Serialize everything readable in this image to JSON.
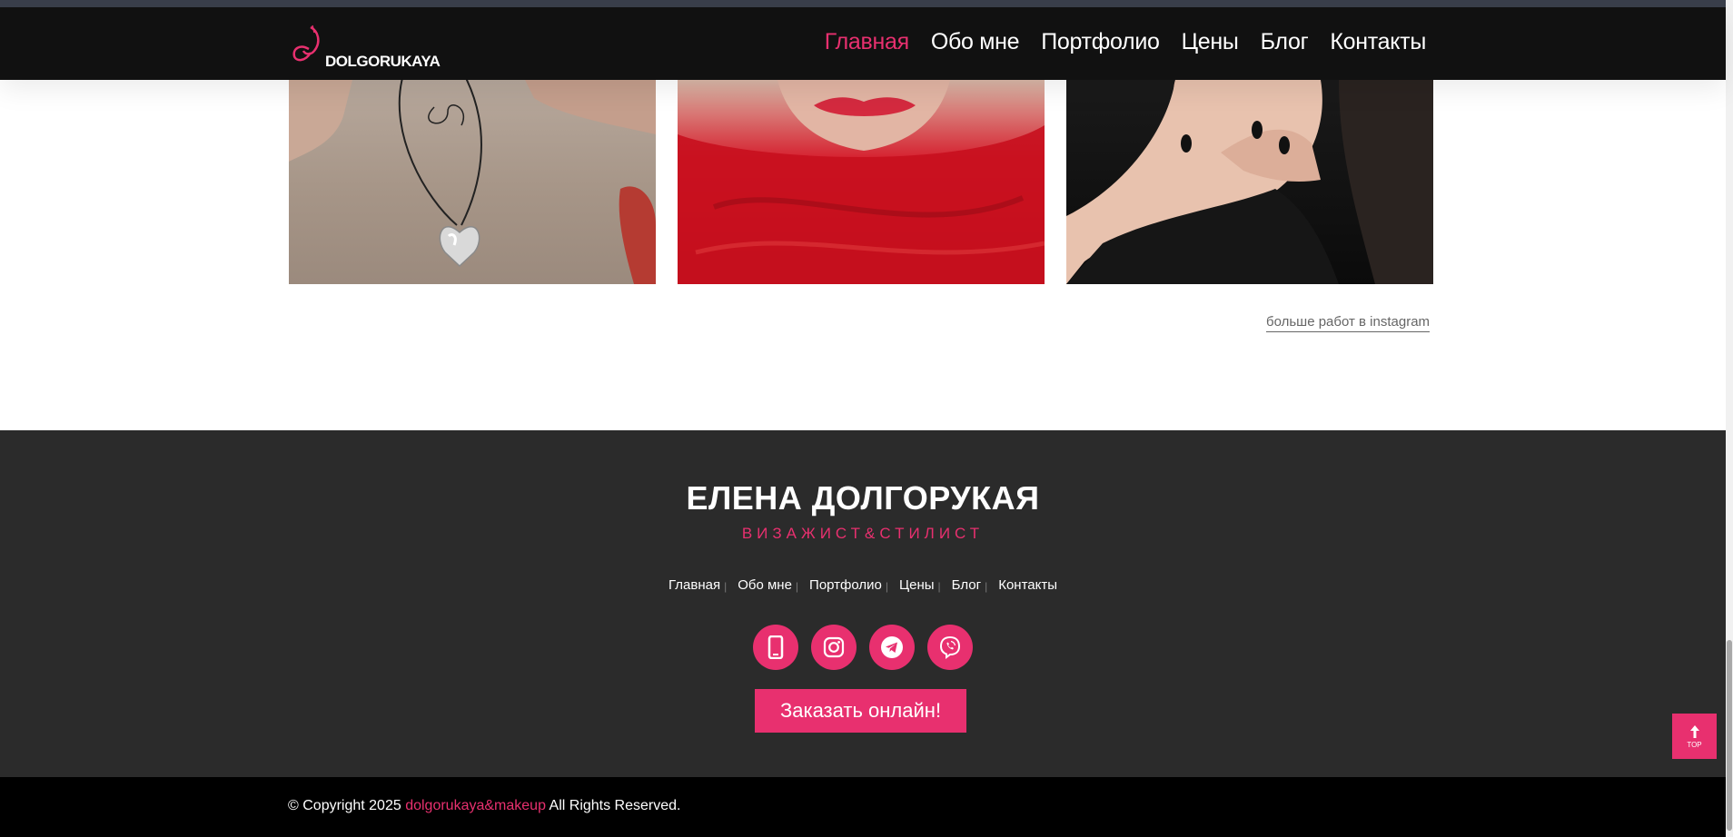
{
  "header": {
    "logo_text": "DOLGORUKAYA",
    "nav": [
      "Главная",
      "Обо мне",
      "Портфолио",
      "Цены",
      "Блог",
      "Контакты"
    ],
    "active_index": 0
  },
  "gallery": {
    "more_link": "больше работ в instagram"
  },
  "footer": {
    "name": "ЕЛЕНА ДОЛГОРУКАЯ",
    "subtitle": "ВИЗАЖИСТ&СТИЛИСТ",
    "nav": [
      "Главная",
      "Обо мне",
      "Портфолио",
      "Цены",
      "Блог",
      "Контакты"
    ],
    "socials": [
      "phone-icon",
      "instagram-icon",
      "telegram-icon",
      "viber-icon"
    ],
    "order_button": "Заказать онлайн!"
  },
  "copyright": {
    "prefix": "© Copyright 2025",
    "brand": "dolgorukaya&makeup",
    "suffix": "All Rights Reserved."
  },
  "top_button": {
    "label": "TOP"
  },
  "colors": {
    "accent": "#e8306f",
    "header_bg": "#111111",
    "footer_bg": "#2b2b2b",
    "bottom_bar_bg": "#000000"
  }
}
